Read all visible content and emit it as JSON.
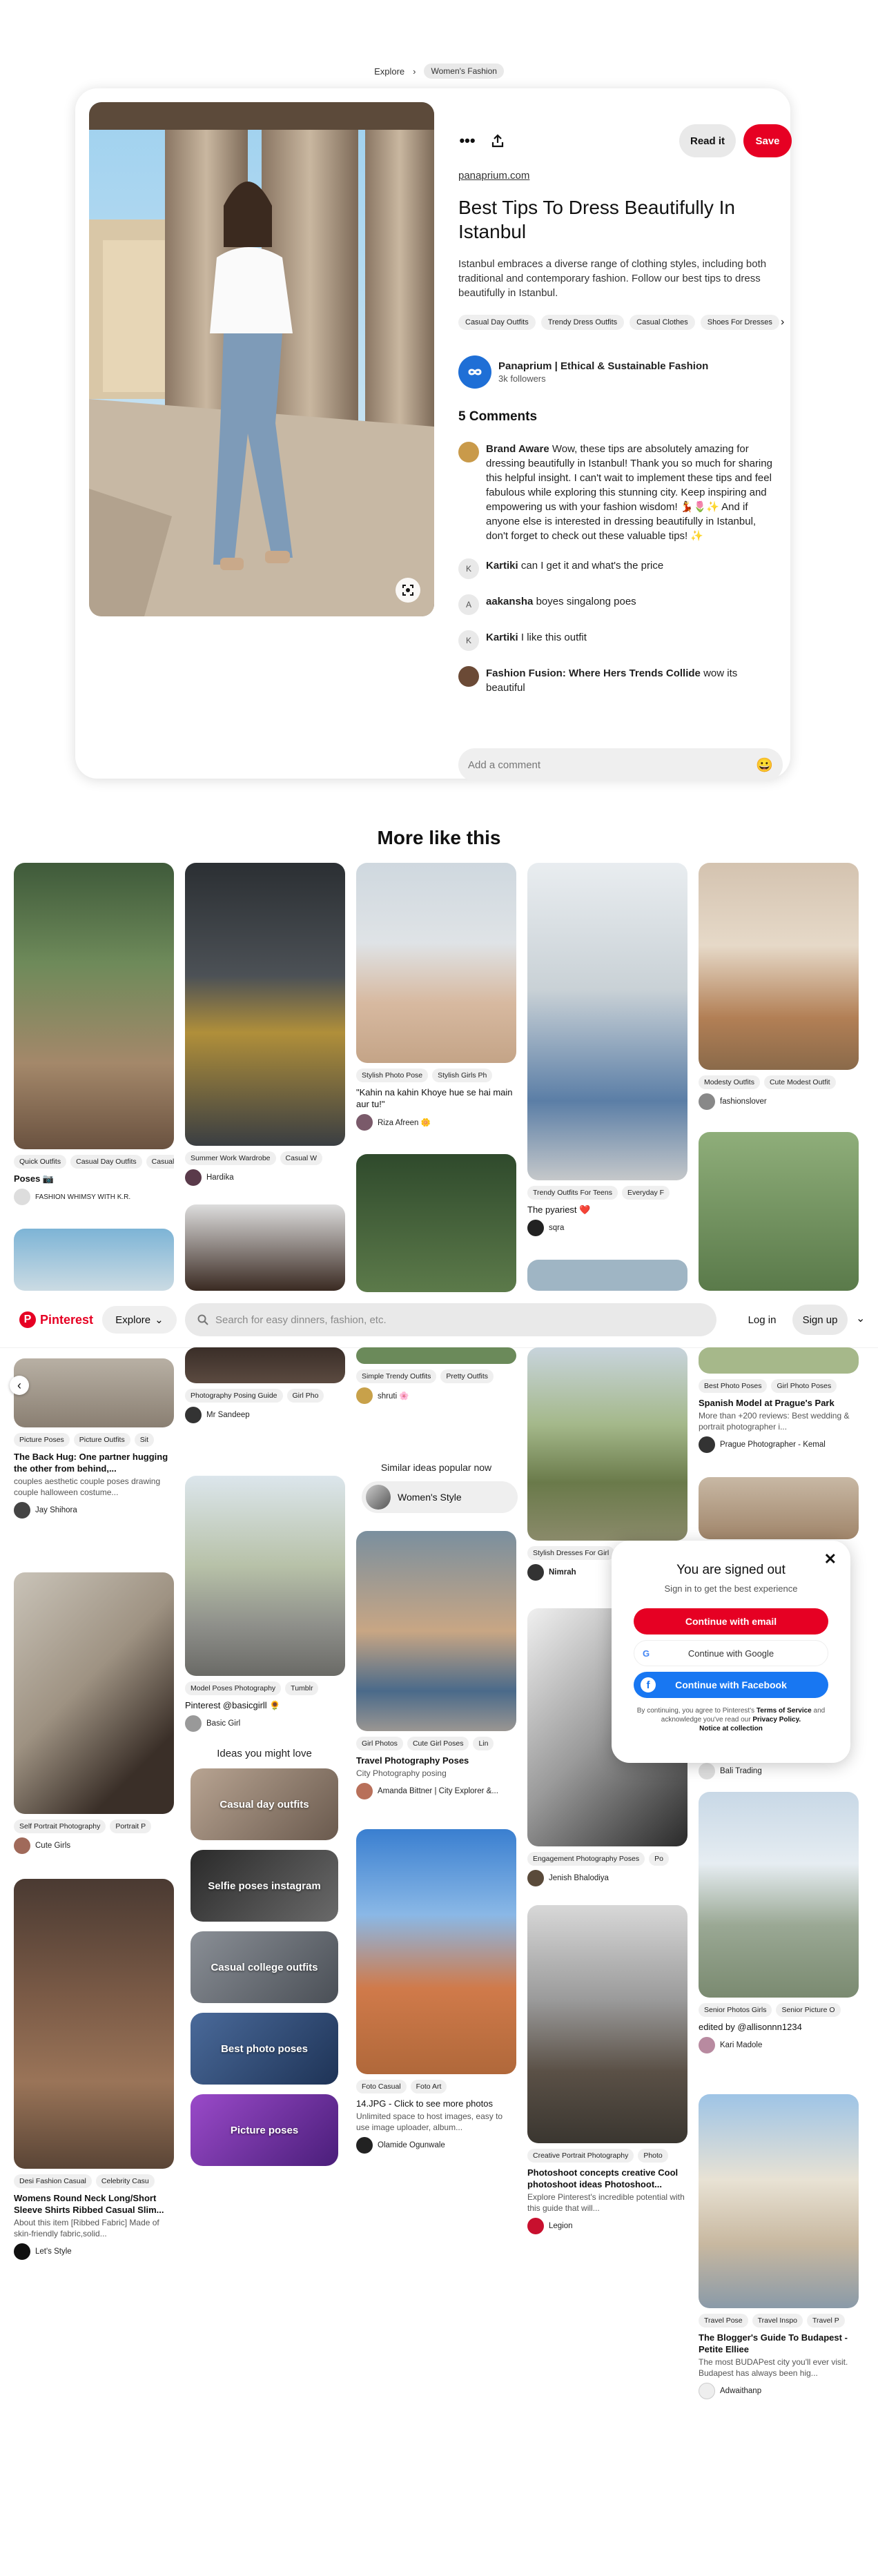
{
  "breadcrumb": {
    "explore": "Explore",
    "current": "Women's Fashion"
  },
  "pin": {
    "read_it": "Read it",
    "save": "Save",
    "domain": "panaprium.com",
    "title": "Best Tips To Dress Beautifully In Istanbul",
    "description": "Istanbul embraces a diverse range of clothing styles, including both traditional and contemporary fashion. Follow our best tips to dress beautifully in Istanbul.",
    "tags": [
      "Casual Day Outfits",
      "Trendy Dress Outfits",
      "Casual Clothes",
      "Shoes For Dresses"
    ],
    "creator": {
      "name": "Panaprium | Ethical & Sustainable Fashion",
      "followers": "3k followers"
    },
    "comments_heading": "5 Comments",
    "comments": [
      {
        "user": "Brand Aware",
        "initial": "",
        "text": "Wow, these tips are absolutely amazing for dressing beautifully in Istanbul! Thank you so much for sharing this helpful insight. I can't wait to implement these tips and feel fabulous while exploring this stunning city. Keep inspiring and empowering us with your fashion wisdom! 💃🌷✨ And if anyone else is interested in dressing beautifully in Istanbul, don't forget to check out these valuable tips! ✨"
      },
      {
        "user": "Kartiki",
        "initial": "K",
        "text": "can I get it and what's the price"
      },
      {
        "user": "aakansha",
        "initial": "A",
        "text": "boyes singalong poes"
      },
      {
        "user": "Kartiki",
        "initial": "K",
        "text": "I like this outfit"
      },
      {
        "user": "Fashion Fusion: Where Hers Trends Collide",
        "initial": "",
        "text": "wow its beautiful"
      }
    ],
    "add_comment_placeholder": "Add a comment",
    "emoji": "😀"
  },
  "more_heading": "More like this",
  "topbar": {
    "brand": "Pinterest",
    "explore": "Explore",
    "search_placeholder": "Search for easy dinners, fashion, etc.",
    "login": "Log in",
    "signup": "Sign up"
  },
  "pins": {
    "c1a": {
      "tags": [
        "Quick Outfits",
        "Casual Day Outfits",
        "Casual"
      ],
      "title": "Poses 📷",
      "user": "FASHION WHIMSY WITH K.R."
    },
    "c1c": {
      "tags": [
        "Picture Poses",
        "Picture Outfits",
        "Sit"
      ],
      "title": "The Back Hug: One partner hugging the other from behind,...",
      "desc": "couples aesthetic couple poses drawing couple halloween costume...",
      "user": "Jay Shihora"
    },
    "c1d": {
      "tags": [
        "Self Portrait Photography",
        "Portrait P"
      ],
      "user": "Cute Girls"
    },
    "c1e": {
      "tags": [
        "Desi Fashion Casual",
        "Celebrity Casu"
      ],
      "title": "Womens Round Neck Long/Short Sleeve Shirts Ribbed Casual Slim...",
      "desc": "About this item [Ribbed Fabric] Made of skin-friendly fabric,solid...",
      "user": "Let's Style"
    },
    "c2a": {
      "tags": [
        "Summer Work Wardrobe",
        "Casual W"
      ],
      "user": "Hardika"
    },
    "c2c": {
      "tags": [
        "Photography Posing Guide",
        "Girl Pho"
      ],
      "user": "Mr Sandeep"
    },
    "c2d": {
      "tags": [
        "Model Poses Photography",
        "Tumblr"
      ],
      "title": "Pinterest @basicgirll 🌻",
      "user": "Basic Girl"
    },
    "ideas_heading": "Ideas you might love",
    "ideas": [
      "Casual day outfits",
      "Selfie poses instagram",
      "Casual college outfits",
      "Best photo poses",
      "Picture poses"
    ],
    "c3a": {
      "tags": [
        "Stylish Photo Pose",
        "Stylish Girls Ph"
      ],
      "title": "\"Kahin na kahin Khoye hue se hai main aur tu!\"",
      "user": "Riza Afreen 🌼"
    },
    "c3b": {
      "tags": [
        "Simple Trendy Outfits",
        "Pretty Outfits"
      ],
      "user": "shruti 🌸"
    },
    "similar": {
      "heading": "Similar ideas popular now",
      "pill": "Women's Style"
    },
    "c3c": {
      "tags": [
        "Girl Photos",
        "Cute Girl Poses",
        "Lin"
      ],
      "title": "Travel Photography Poses",
      "desc": "City Photography posing",
      "user": "Amanda Bittner | City Explorer &..."
    },
    "c3d": {
      "tags": [
        "Foto Casual",
        "Foto Art"
      ],
      "title": "14.JPG - Click to see more photos",
      "desc": "Unlimited space to host images, easy to use image uploader, album...",
      "user": "Olamide Ogunwale"
    },
    "c4a": {
      "tags": [
        "Trendy Outfits For Teens",
        "Everyday F"
      ],
      "title": "The pyariest ❤️",
      "user": "sqra"
    },
    "c4b": {
      "tags": [
        "Stylish Dresses For Girl"
      ],
      "user": "Nimrah"
    },
    "c4c": {
      "tags": [
        "Engagement Photography Poses",
        "Po"
      ],
      "user": "Jenish Bhalodiya"
    },
    "c4d": {
      "tags": [
        "Creative Portrait Photography",
        "Photo"
      ],
      "title": "Photoshoot concepts creative Cool photoshoot ideas Photoshoot...",
      "desc": "Explore Pinterest's incredible potential with this guide that will...",
      "user": "Legion"
    },
    "c5a": {
      "tags": [
        "Modesty Outfits",
        "Cute Modest Outfit"
      ],
      "user": "fashionslover"
    },
    "c5b": {
      "tags": [
        "Best Photo Poses",
        "Girl Photo Poses"
      ],
      "title": "Spanish Model at Prague's Park",
      "desc": "More than +200 reviews: Best wedding & portrait photographer i...",
      "user": "Prague Photographer - Kemal"
    },
    "c5c": {
      "user": "Bali Trading"
    },
    "c5d": {
      "tags": [
        "Senior Photos Girls",
        "Senior Picture O"
      ],
      "title": "edited by @allisonnn1234",
      "user": "Kari Madole"
    },
    "c5e": {
      "tags": [
        "Travel Pose",
        "Travel Inspo",
        "Travel P"
      ],
      "title": "The Blogger's Guide To Budapest - Petite Elliee",
      "desc": "The most BUDAPest city you'll ever visit. Budapest has always been hig...",
      "user": "Adwaithanp"
    }
  },
  "modal": {
    "title": "You are signed out",
    "subtitle": "Sign in to get the best experience",
    "email": "Continue with email",
    "google": "Continue with Google",
    "facebook": "Continue with Facebook",
    "legal1": "By continuing, you agree to Pinterest's",
    "terms": "Terms of Service",
    "legal2": "and acknowledge you've read our",
    "privacy": "Privacy Policy.",
    "notice": "Notice at collection"
  },
  "colors": {
    "brand_red": "#e60023",
    "facebook_blue": "#1877f2"
  }
}
